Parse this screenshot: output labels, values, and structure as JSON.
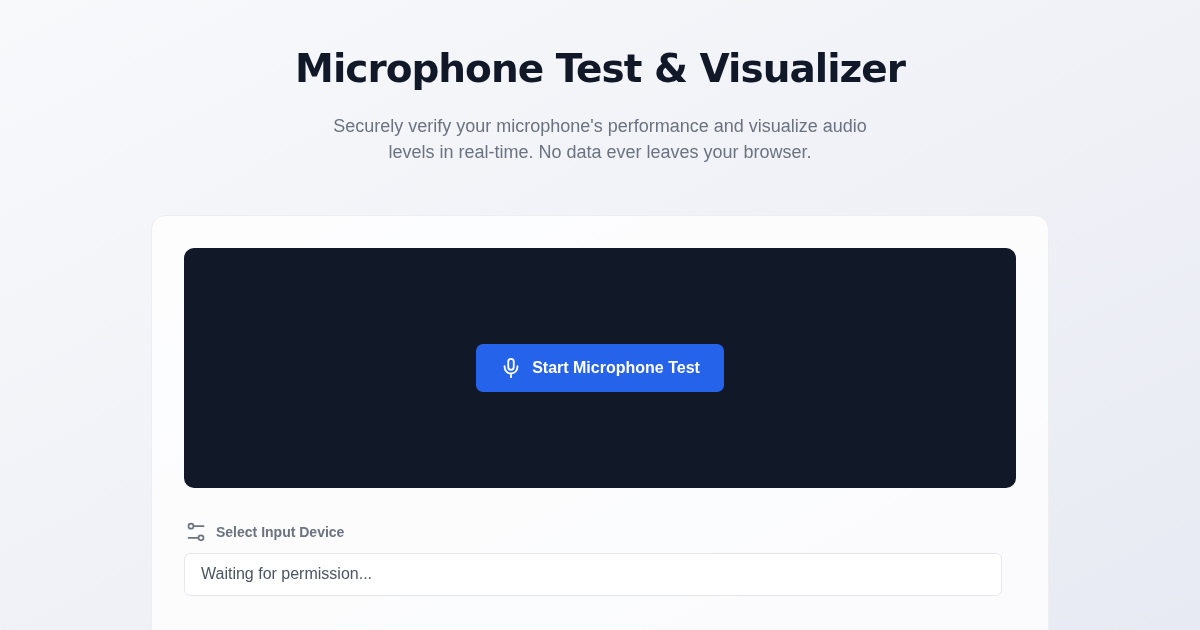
{
  "header": {
    "title": "Microphone Test & Visualizer",
    "subtitle": "Securely verify your microphone's performance and visualize audio levels in real-time. No data ever leaves your browser."
  },
  "visualizer": {
    "start_button": "Start Microphone Test"
  },
  "device": {
    "label": "Select Input Device",
    "select_value": "Waiting for permission..."
  }
}
